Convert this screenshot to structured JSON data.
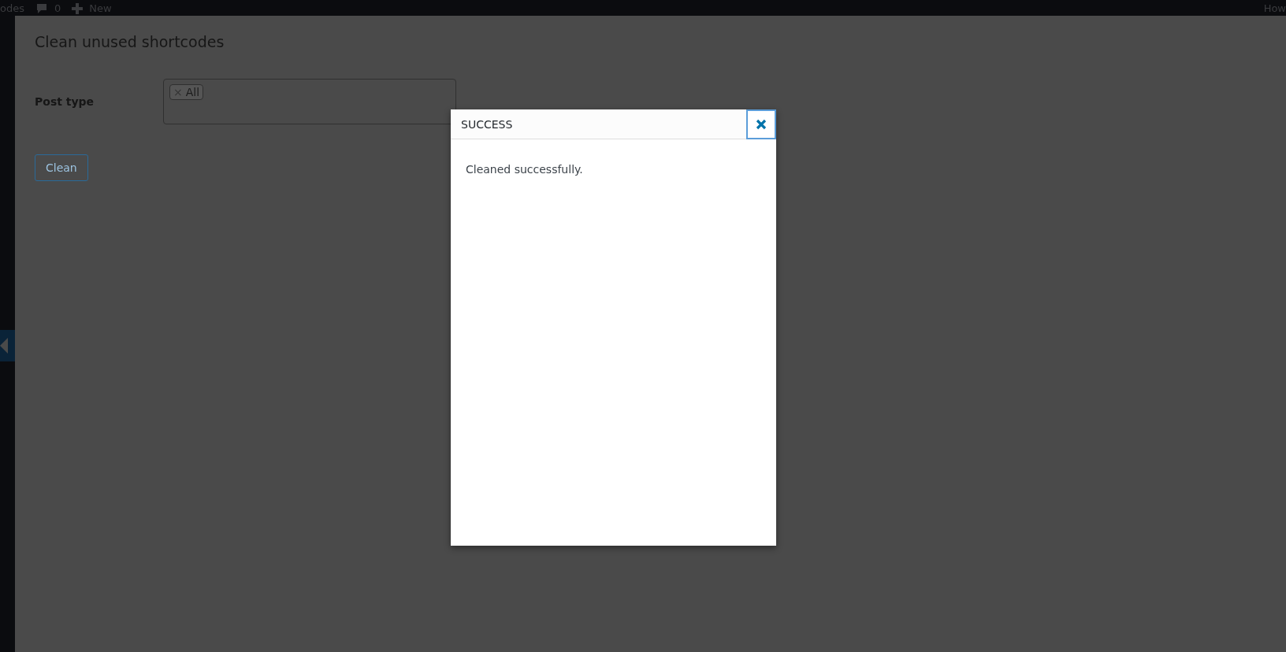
{
  "admin_bar": {
    "left_items": [
      {
        "kind": "text",
        "label": "odes"
      },
      {
        "kind": "comments",
        "label": "0"
      },
      {
        "kind": "new",
        "label": "New"
      }
    ],
    "right_items": [
      "How"
    ]
  },
  "page": {
    "title": "Clean unused shortcodes",
    "post_type": {
      "label": "Post type",
      "tags": [
        {
          "remove": "×",
          "label": "All"
        }
      ]
    },
    "button": "Clean"
  },
  "modal": {
    "title": "SUCCESS",
    "message": "Cleaned successfully."
  }
}
